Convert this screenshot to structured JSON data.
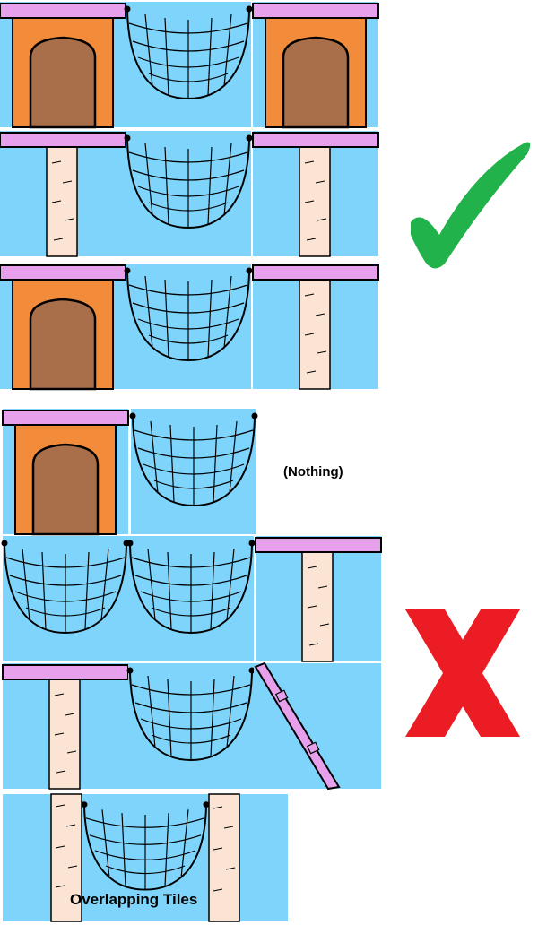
{
  "labels": {
    "nothing": "(Nothing)",
    "overlapping": "Overlapping Tiles"
  },
  "verdicts": {
    "good": "check-mark",
    "bad": "cross-mark"
  },
  "colors": {
    "sky": "#7fd4fb",
    "platform": "#e6a0ec",
    "wall": "#f28c3a",
    "door": "#a96f4a",
    "trunk": "#fbe4d4",
    "net": "#000000",
    "check": "#22b24c",
    "cross": "#ec1c24"
  },
  "tiles": {
    "rows": [
      {
        "name": "good-row-1",
        "cells": [
          "door-tile",
          "net-tile",
          "door-tile"
        ]
      },
      {
        "name": "good-row-2",
        "cells": [
          "trunk-tile",
          "net-tile",
          "trunk-tile"
        ]
      },
      {
        "name": "good-row-3",
        "cells": [
          "door-tile",
          "net-tile",
          "trunk-tile"
        ]
      },
      {
        "name": "bad-row-1",
        "cells": [
          "door-tile",
          "net-tile",
          "empty"
        ]
      },
      {
        "name": "bad-row-2",
        "cells": [
          "net-tile",
          "net-tile",
          "trunk-tile"
        ]
      },
      {
        "name": "bad-row-3",
        "cells": [
          "trunk-tile",
          "net-tile",
          "tilted-platform-tile"
        ]
      },
      {
        "name": "bad-row-4",
        "cells": [
          "overlapping-trunks-and-net"
        ]
      }
    ]
  }
}
